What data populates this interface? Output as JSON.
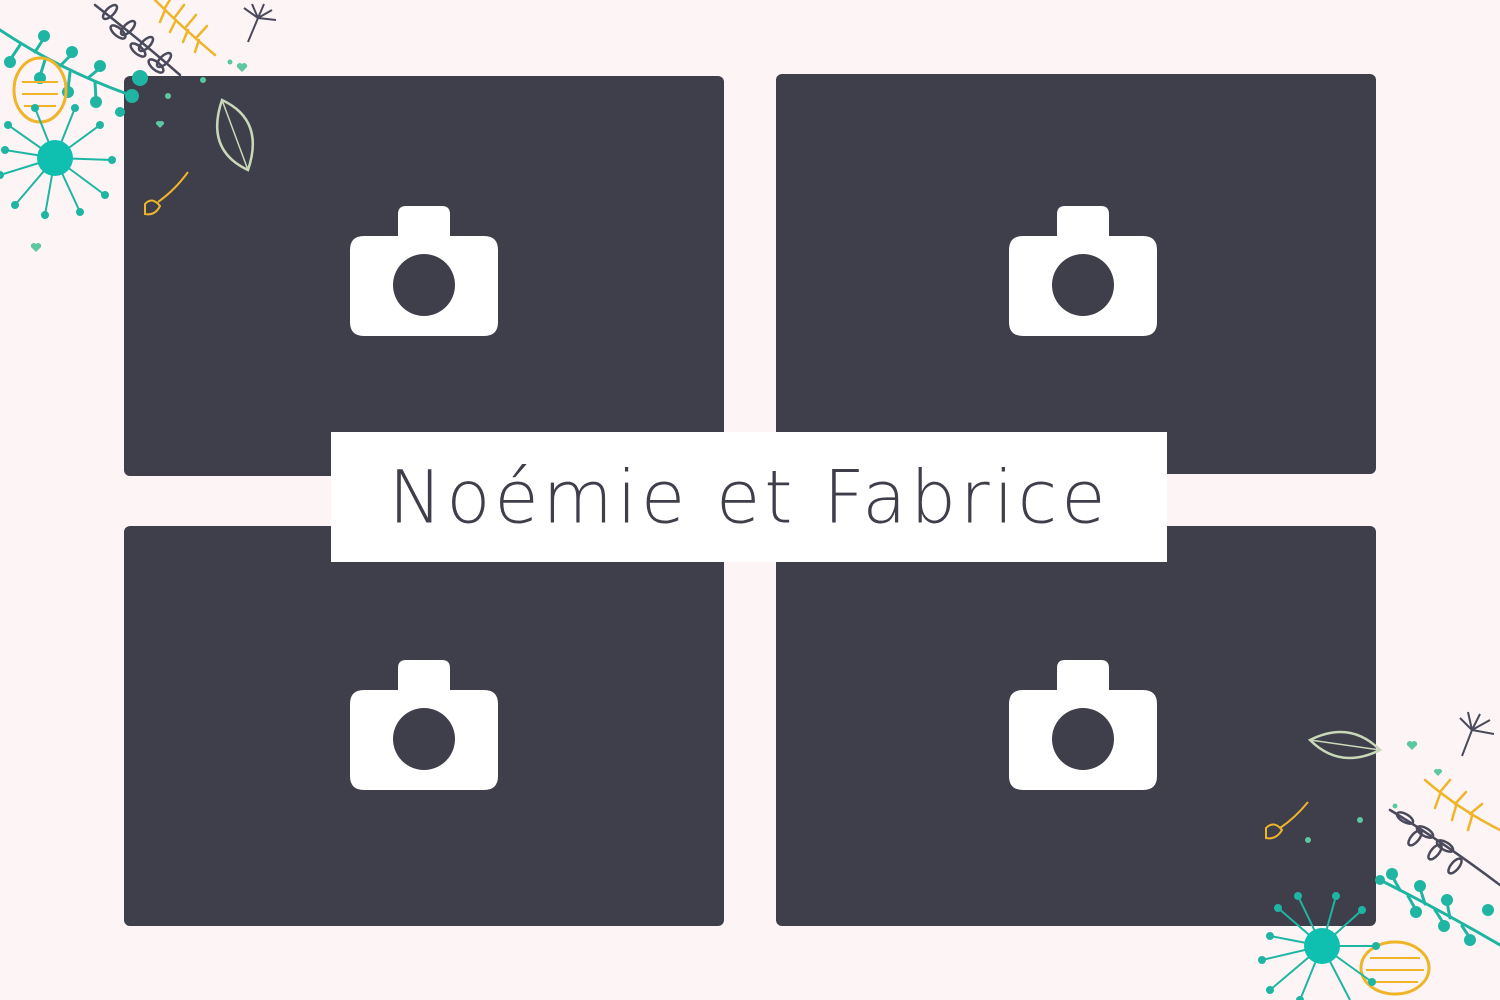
{
  "title": "Noémie et Fabrice",
  "photo_slots": [
    {
      "icon": "camera-icon"
    },
    {
      "icon": "camera-icon"
    },
    {
      "icon": "camera-icon"
    },
    {
      "icon": "camera-icon"
    }
  ],
  "colors": {
    "background": "#fdf5f5",
    "slot": "#3f3e4b",
    "title_box": "#ffffff",
    "title_text": "#3f3e4b",
    "teal": "#1fb5a3",
    "mint": "#5cc7a0",
    "yellow": "#f0b429",
    "navy": "#4a4a5c"
  },
  "decorations": [
    "floral-corner-top-left",
    "floral-corner-bottom-right"
  ]
}
